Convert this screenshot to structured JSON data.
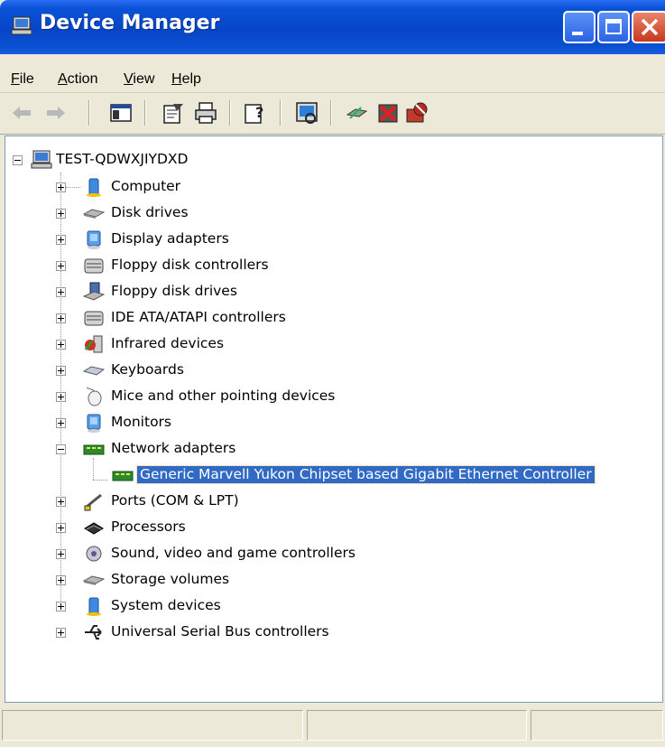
{
  "window": {
    "title": "Device Manager"
  },
  "menu": {
    "file": "File",
    "action": "Action",
    "view": "View",
    "help": "Help"
  },
  "toolbar": {
    "icons": [
      "back-arrow-icon",
      "forward-arrow-icon",
      "show-hide-console-tree-icon",
      "properties-icon",
      "print-icon",
      "help-icon",
      "scan-hardware-icon",
      "update-driver-icon",
      "uninstall-device-icon",
      "disable-device-icon"
    ]
  },
  "tree": {
    "root": "TEST-QDWXJIYDXD",
    "categories": [
      "Computer",
      "Disk drives",
      "Display adapters",
      "Floppy disk controllers",
      "Floppy disk drives",
      "IDE ATA/ATAPI controllers",
      "Infrared devices",
      "Keyboards",
      "Mice and other pointing devices",
      "Monitors",
      "Network adapters",
      "Ports (COM & LPT)",
      "Processors",
      "Sound, video and game controllers",
      "Storage volumes",
      "System devices",
      "Universal Serial Bus controllers"
    ],
    "network_child": "Generic Marvell Yukon Chipset based Gigabit Ethernet Controller"
  },
  "colors": {
    "titlebar": "#0646c6",
    "selection": "#316ac5",
    "background": "#ece9d8"
  }
}
